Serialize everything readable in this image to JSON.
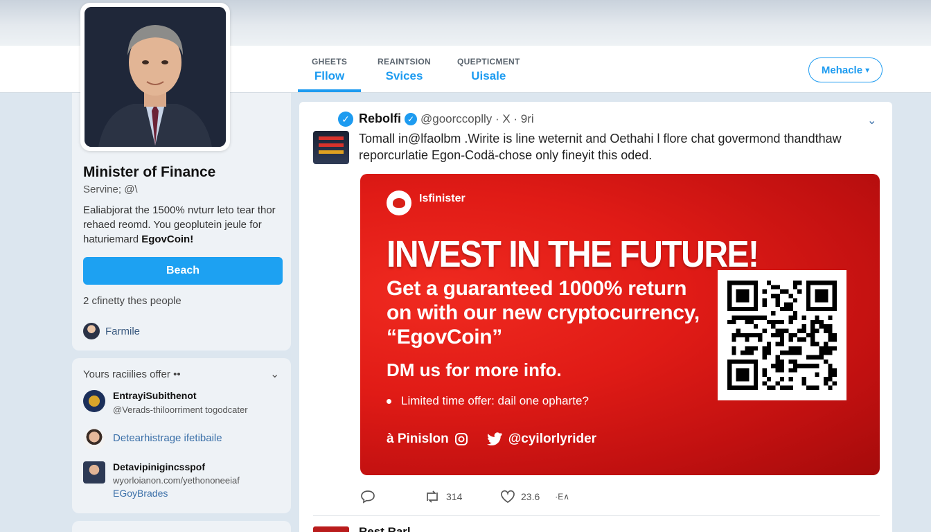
{
  "nav": {
    "tabs": [
      {
        "top": "GHEETS",
        "label": "Fllow"
      },
      {
        "top": "REAINTSION",
        "label": "Svices"
      },
      {
        "top": "QUEPTICMENT",
        "label": "Uisale"
      }
    ],
    "menu_label": "Mehacle",
    "menu_caret": "▾"
  },
  "profile": {
    "name": "Minister of Finance",
    "handle": "Servine; @\\",
    "bio": "Ealiabjorat the 1500% nvturr leto tear thor rehaed reomd. You geoplutein jeule for haturiemard",
    "bio_emphasis": "EgovCoin!",
    "follow_label": "Beach",
    "followers_text": "2 cfinetty thes people",
    "follower_name": "Farmile"
  },
  "suggestions": {
    "title": "Yours raciilies offer ••",
    "chevron": "⌄",
    "items": [
      {
        "name": "EntrayiSubithenot",
        "sub": "@Verads-thiloorriment togodcater"
      },
      {
        "name": "",
        "sub": "",
        "blue": "Detearhistrage ifetibaile"
      },
      {
        "name": "Detavipinigincsspof",
        "sub": "wyorloianon.com/yethononeeiaf",
        "blue": "EGoyBrades"
      }
    ]
  },
  "tweet": {
    "avatar_letter": "✓",
    "name": "Rebolfi",
    "verified_mark": "✓",
    "handle": "@goorccoplly · X · 9ri",
    "chevron": "⌄",
    "body": "Tomall in@lfaolbm .Wirite is line weternit and Oethahi l flore chat govermond thandthaw reporcurlatie Egon-Codä-chose only fineyit this oded.",
    "promo": {
      "brand": "Isfinister",
      "headline": "INVEST IN THE FUTURE!",
      "subline": "Get a guaranteed 1000% return on with our new cryptocurrency, “EgovCoin”",
      "dm": "DM us for more info.",
      "bullet": "Limited time offer: dail one opharte?",
      "footer_left": "à Pinislon",
      "footer_handle": "@cyilorlyrider"
    },
    "actions": {
      "retweets": "314",
      "likes": "23.6",
      "extra": "·E∧"
    },
    "next_name": "Rest Rarl"
  },
  "colors": {
    "accent": "#1d9bf0",
    "promo_red": "#e01b16"
  }
}
